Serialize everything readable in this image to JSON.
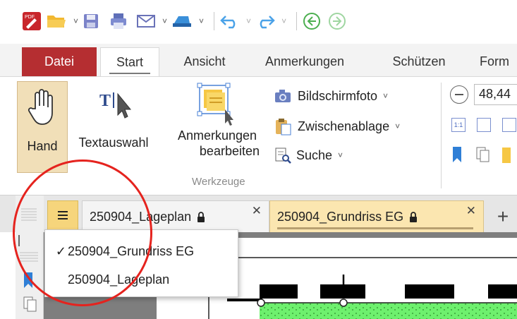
{
  "quick_access": {
    "icons": [
      "app-logo-icon",
      "open-folder-icon",
      "save-icon",
      "print-icon",
      "email-icon",
      "scan-icon",
      "undo-icon",
      "redo-icon",
      "back-icon",
      "forward-icon"
    ]
  },
  "ribbon_tabs": {
    "datei": "Datei",
    "start": "Start",
    "ansicht": "Ansicht",
    "anmerkungen": "Anmerkungen",
    "schuetzen": "Schützen",
    "form": "Form"
  },
  "ribbon": {
    "hand_label": "Hand",
    "textauswahl_label": "Textauswahl",
    "anmerkungen_line1": "Anmerkungen",
    "anmerkungen_line2": "bearbeiten",
    "group_label": "Werkzeuge",
    "bildschirmfoto": "Bildschirmfoto",
    "zwischenablage": "Zwischenablage",
    "suche": "Suche",
    "zoom_value": "48,44"
  },
  "document_tabs": [
    {
      "label": "250904_Lageplan",
      "active": false
    },
    {
      "label": "250904_Grundriss EG",
      "active": true
    }
  ],
  "tab_list_menu": {
    "items": [
      {
        "label": "250904_Grundriss EG",
        "checked": true
      },
      {
        "label": "250904_Lageplan",
        "checked": false
      }
    ],
    "check_mark": "✓"
  },
  "colors": {
    "datei_red": "#b52e31",
    "active_tab_yellow": "#fbe6b0",
    "annotation_red": "#e5231e",
    "hatch_green": "#6ef06e"
  }
}
